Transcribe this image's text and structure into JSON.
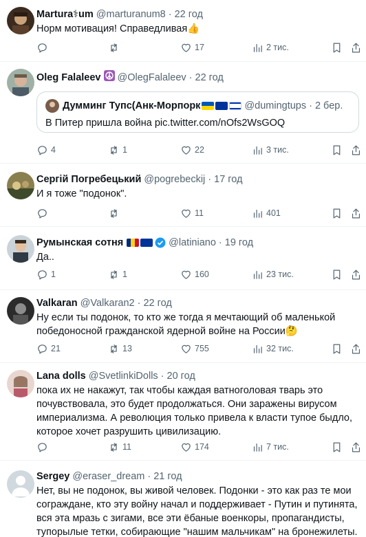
{
  "tweets": [
    {
      "name": "Martura⚕um",
      "handle": "@marturanum8",
      "time": "22 год",
      "text": "Норм мотивация! Справедливая👍",
      "replies": "",
      "retweets": "",
      "likes": "17",
      "views": "2 тис."
    },
    {
      "name": "Oleg Falaleev",
      "handle": "@OlegFalaleev",
      "time": "22 год",
      "text": "",
      "quote": {
        "name": "Думминг Тупс(Анк-Морпорк",
        "handle": "@dumingtups",
        "time": "2 бер.",
        "text": "В Питер пришла война pic.twitter.com/nOfs2WsGOQ"
      },
      "replies": "4",
      "retweets": "1",
      "likes": "22",
      "views": "3 тис."
    },
    {
      "name": "Сергій Погребецький",
      "handle": "@pogrebeckij",
      "time": "17 год",
      "text": "И я тоже \"подонок\".",
      "replies": "",
      "retweets": "",
      "likes": "11",
      "views": "401"
    },
    {
      "name": "Румынская сотня",
      "handle": "@latiniano",
      "time": "19 год",
      "text": "Да..",
      "replies": "1",
      "retweets": "1",
      "likes": "160",
      "views": "23 тис."
    },
    {
      "name": "Valkaran",
      "handle": "@Valkaran2",
      "time": "22 год",
      "text": "Ну если ты подонок, то кто же тогда я мечтающий об маленькой победоносной гражданской ядерной войне на России🤔",
      "replies": "21",
      "retweets": "13",
      "likes": "755",
      "views": "32 тис."
    },
    {
      "name": "Lana dolls",
      "handle": "@SvetlinkiDolls",
      "time": "20 год",
      "text": "пока их не накажут, так чтобы каждая ватноголовая тварь это почувствовала, это будет продолжаться. Они заражены вирусом империализма. А революция только привела к власти тупое быдло, которое хочет разрушить цивилизацию.",
      "replies": "",
      "retweets": "11",
      "likes": "174",
      "views": "7 тис."
    },
    {
      "name": "Sergey",
      "handle": "@eraser_dream",
      "time": "21 год",
      "text": "Нет, вы не подонок, вы живой человек. Подонки - это как раз те мои сограждане, кто эту войну начал и поддерживает - Путин и путинята, вся эта мразь с зигами, все эти ёбаные военкоры, пропагандисты, тупорылые тетки, собирающие \"нашим мальчикам\" на бронежилеты."
    }
  ],
  "colors": {
    "text": "#0f1419",
    "secondary": "#536471",
    "divider": "#eff3f4",
    "verified": "#1d9bf0"
  }
}
